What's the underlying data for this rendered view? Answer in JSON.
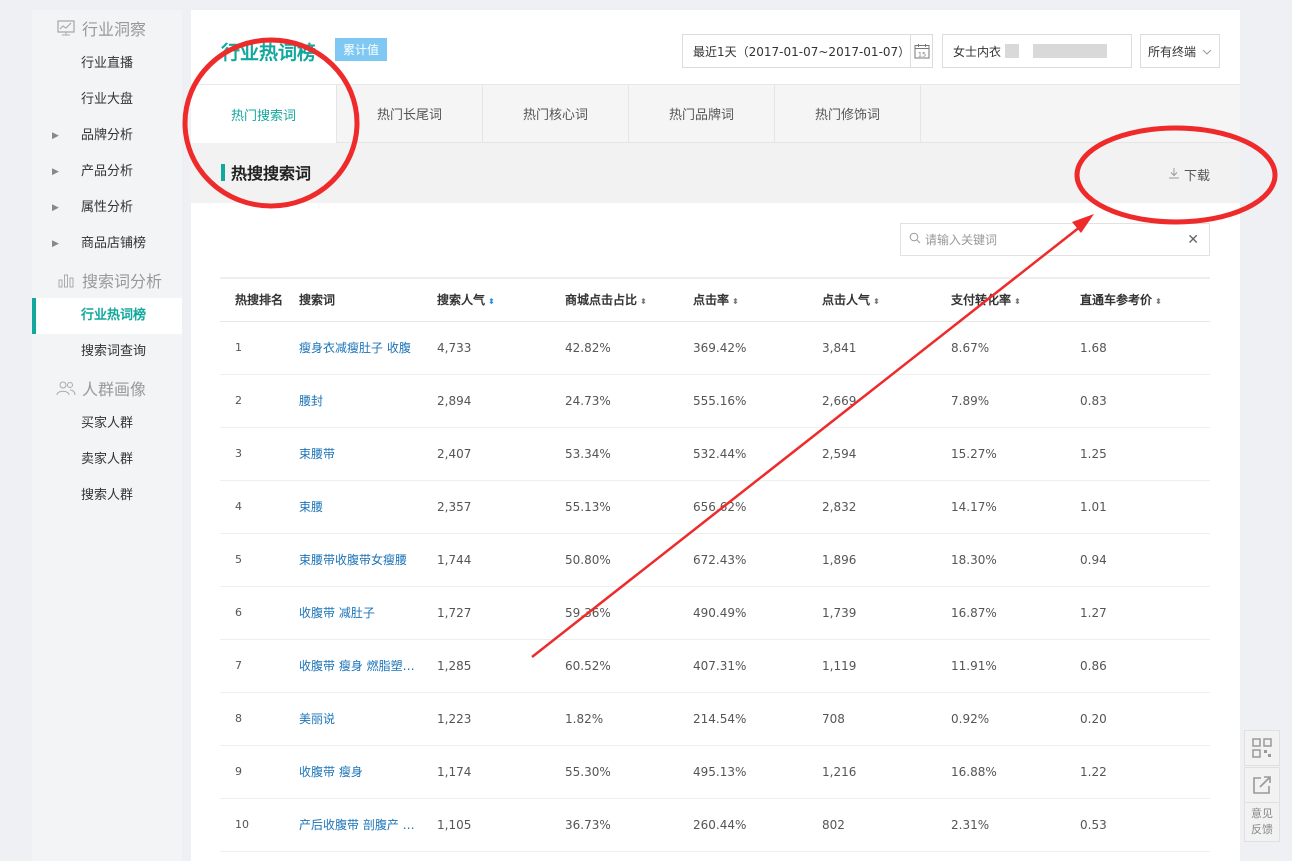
{
  "sidebar": {
    "groups": [
      {
        "title": "行业洞察",
        "icon": "monitor-chart-icon",
        "items": [
          {
            "label": "行业直播",
            "expandable": false
          },
          {
            "label": "行业大盘",
            "expandable": false
          },
          {
            "label": "品牌分析",
            "expandable": true
          },
          {
            "label": "产品分析",
            "expandable": true
          },
          {
            "label": "属性分析",
            "expandable": true
          },
          {
            "label": "商品店铺榜",
            "expandable": true
          }
        ]
      },
      {
        "title": "搜索词分析",
        "icon": "bar-chart-icon",
        "items": [
          {
            "label": "行业热词榜",
            "expandable": false,
            "active": true
          },
          {
            "label": "搜索词查询",
            "expandable": false
          }
        ]
      },
      {
        "title": "人群画像",
        "icon": "people-icon",
        "items": [
          {
            "label": "买家人群",
            "expandable": false
          },
          {
            "label": "卖家人群",
            "expandable": false
          },
          {
            "label": "搜索人群",
            "expandable": false
          }
        ]
      }
    ]
  },
  "header": {
    "title": "行业热词榜",
    "badge": "累计值",
    "date_range": "最近1天（2017-01-07~2017-01-07）",
    "calendar_day": "15",
    "category": "女士内衣",
    "device": "所有终端"
  },
  "tabs": [
    "热门搜索词",
    "热门长尾词",
    "热门核心词",
    "热门品牌词",
    "热门修饰词"
  ],
  "section": {
    "title": "热搜搜索词",
    "download": "下载",
    "search_placeholder": "请输入关键词"
  },
  "table": {
    "columns": [
      "热搜排名",
      "搜索词",
      "搜索人气",
      "商城点击占比",
      "点击率",
      "点击人气",
      "支付转化率",
      "直通车参考价"
    ],
    "rows": [
      [
        "1",
        "瘦身衣减瘦肚子 收腹",
        "4,733",
        "42.82%",
        "369.42%",
        "3,841",
        "8.67%",
        "1.68"
      ],
      [
        "2",
        "腰封",
        "2,894",
        "24.73%",
        "555.16%",
        "2,669",
        "7.89%",
        "0.83"
      ],
      [
        "3",
        "束腰带",
        "2,407",
        "53.34%",
        "532.44%",
        "2,594",
        "15.27%",
        "1.25"
      ],
      [
        "4",
        "束腰",
        "2,357",
        "55.13%",
        "656.62%",
        "2,832",
        "14.17%",
        "1.01"
      ],
      [
        "5",
        "束腰带收腹带女瘦腰",
        "1,744",
        "50.80%",
        "672.43%",
        "1,896",
        "18.30%",
        "0.94"
      ],
      [
        "6",
        "收腹带 减肚子",
        "1,727",
        "59.36%",
        "490.49%",
        "1,739",
        "16.87%",
        "1.27"
      ],
      [
        "7",
        "收腹带 瘦身 燃脂塑…",
        "1,285",
        "60.52%",
        "407.31%",
        "1,119",
        "11.91%",
        "0.86"
      ],
      [
        "8",
        "美丽说",
        "1,223",
        "1.82%",
        "214.54%",
        "708",
        "0.92%",
        "0.20"
      ],
      [
        "9",
        "收腹带 瘦身",
        "1,174",
        "55.30%",
        "495.13%",
        "1,216",
        "16.88%",
        "1.22"
      ],
      [
        "10",
        "产后收腹带 剖腹产 …",
        "1,105",
        "36.73%",
        "260.44%",
        "802",
        "2.31%",
        "0.53"
      ]
    ]
  },
  "float": {
    "feedback_line1": "意见",
    "feedback_line2": "反馈"
  },
  "colors": {
    "accent": "#13a89e",
    "link": "#1b74b8",
    "annotation": "#ee2a2a"
  }
}
